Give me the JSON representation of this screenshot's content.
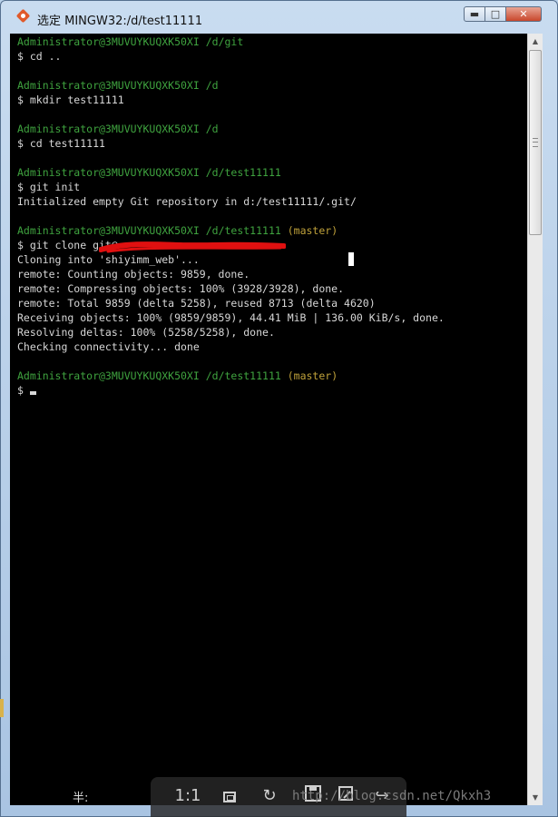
{
  "window": {
    "title": "选定 MINGW32:/d/test11111",
    "minimize_label": "▬",
    "maximize_label": "□",
    "close_label": "✕"
  },
  "terminal": {
    "lines": [
      {
        "type": "prompt",
        "user": "Administrator@3MUVUYKUQXK50XI",
        "path": " /d/git",
        "branch": ""
      },
      {
        "type": "out",
        "text": "$ cd .."
      },
      {
        "type": "blank",
        "text": ""
      },
      {
        "type": "prompt",
        "user": "Administrator@3MUVUYKUQXK50XI",
        "path": " /d",
        "branch": ""
      },
      {
        "type": "out",
        "text": "$ mkdir test11111"
      },
      {
        "type": "blank",
        "text": ""
      },
      {
        "type": "prompt",
        "user": "Administrator@3MUVUYKUQXK50XI",
        "path": " /d",
        "branch": ""
      },
      {
        "type": "out",
        "text": "$ cd test11111"
      },
      {
        "type": "blank",
        "text": ""
      },
      {
        "type": "prompt",
        "user": "Administrator@3MUVUYKUQXK50XI",
        "path": " /d/test11111",
        "branch": ""
      },
      {
        "type": "out",
        "text": "$ git init"
      },
      {
        "type": "out",
        "text": "Initialized empty Git repository in d:/test11111/.git/"
      },
      {
        "type": "blank",
        "text": ""
      },
      {
        "type": "prompt",
        "user": "Administrator@3MUVUYKUQXK50XI",
        "path": " /d/test11111",
        "branch": " (master)"
      },
      {
        "type": "out",
        "text": "$ git clone git@"
      },
      {
        "type": "out",
        "text": "Cloning into 'shiyimm_web'..."
      },
      {
        "type": "out",
        "text": "remote: Counting objects: 9859, done."
      },
      {
        "type": "out",
        "text": "remote: Compressing objects: 100% (3928/3928), done."
      },
      {
        "type": "out",
        "text": "remote: Total 9859 (delta 5258), reused 8713 (delta 4620)"
      },
      {
        "type": "out",
        "text": "Receiving objects: 100% (9859/9859), 44.41 MiB | 136.00 KiB/s, done."
      },
      {
        "type": "out",
        "text": "Resolving deltas: 100% (5258/5258), done."
      },
      {
        "type": "out",
        "text": "Checking connectivity... done"
      },
      {
        "type": "blank",
        "text": ""
      },
      {
        "type": "prompt",
        "user": "Administrator@3MUVUYKUQXK50XI",
        "path": " /d/test11111",
        "branch": " (master)"
      },
      {
        "type": "cursor",
        "text": "$ "
      }
    ]
  },
  "ime": {
    "label": "半:"
  },
  "toolbar": {
    "actual_size_label": "1:1"
  },
  "watermark": {
    "text": "http://blog.csdn.net/Qkxh3"
  }
}
